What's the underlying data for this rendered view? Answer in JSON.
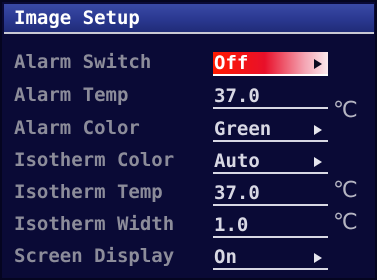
{
  "window": {
    "title": "Image Setup"
  },
  "menu": {
    "alarm_switch": {
      "label": "Alarm Switch",
      "value": "Off"
    },
    "alarm_temp": {
      "label": "Alarm Temp",
      "value": "37.0",
      "unit": "℃"
    },
    "alarm_color": {
      "label": "Alarm Color",
      "value": "Green"
    },
    "isotherm_color": {
      "label": "Isotherm Color",
      "value": "Auto"
    },
    "isotherm_temp": {
      "label": "Isotherm Temp",
      "value": "37.0",
      "unit": "℃"
    },
    "isotherm_width": {
      "label": "Isotherm Width",
      "value": "1.0",
      "unit": "℃"
    },
    "screen_display": {
      "label": "Screen Display",
      "value": "On"
    }
  },
  "colors": {
    "background": "#0a0a36",
    "title_bar": "#2a3890",
    "selected_highlight": "#ff1a00",
    "label_text": "#8c8c9a",
    "value_text": "#d8d8e4"
  },
  "icons": {
    "option_arrow": "triangle-right",
    "unit_symbol": "degree-celsius"
  }
}
